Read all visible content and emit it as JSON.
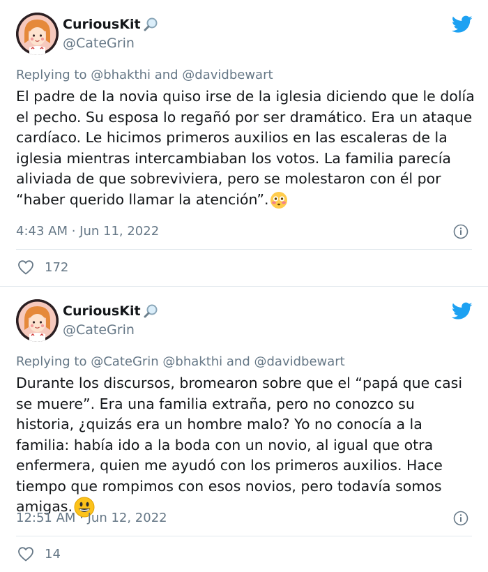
{
  "tweets": [
    {
      "display_name": "CuriousKit",
      "handle": "@CateGrin",
      "replying_prefix": "Replying to",
      "replying_mentions": "@bhakthi and @davidbewart",
      "text": "El padre de la novia quiso irse de la iglesia diciendo que le dolía el pecho. Su esposa lo regañó por ser dramático. Era un ataque cardíaco. Le hicimos primeros auxilios en las escaleras de la iglesia mientras intercambiaban los votos. La familia parecía aliviada de que sobreviviera, pero se molestaron con él por “haber querido llamar la atención”.",
      "emoji": "flushed-face-emoji",
      "timestamp": "4:43 AM · Jun 11, 2022",
      "likes": "172"
    },
    {
      "display_name": "CuriousKit",
      "handle": "@CateGrin",
      "replying_prefix": "Replying to",
      "replying_mentions": "@CateGrin @bhakthi and @davidbewart",
      "text": "Durante los discursos, bromearon sobre que el “papá que casi se muere”. Era una familia extraña, pero no conozco su historia, ¿quizás era un hombre malo? Yo no conocía a la familia: había ido a la boda con un novio, al igual que otra enfermera, quien me ayudó con los primeros auxilios. Hace tiempo que rompimos con esos novios, pero todavía somos amigas.",
      "emoji": "grinning-face-emoji",
      "timestamp": "12:51 AM · Jun 12, 2022",
      "likes": "14"
    }
  ],
  "colors": {
    "twitter_blue": "#1da1f2",
    "secondary_text": "#657786",
    "primary_text": "#14171a",
    "divider": "#e1e8ed"
  }
}
